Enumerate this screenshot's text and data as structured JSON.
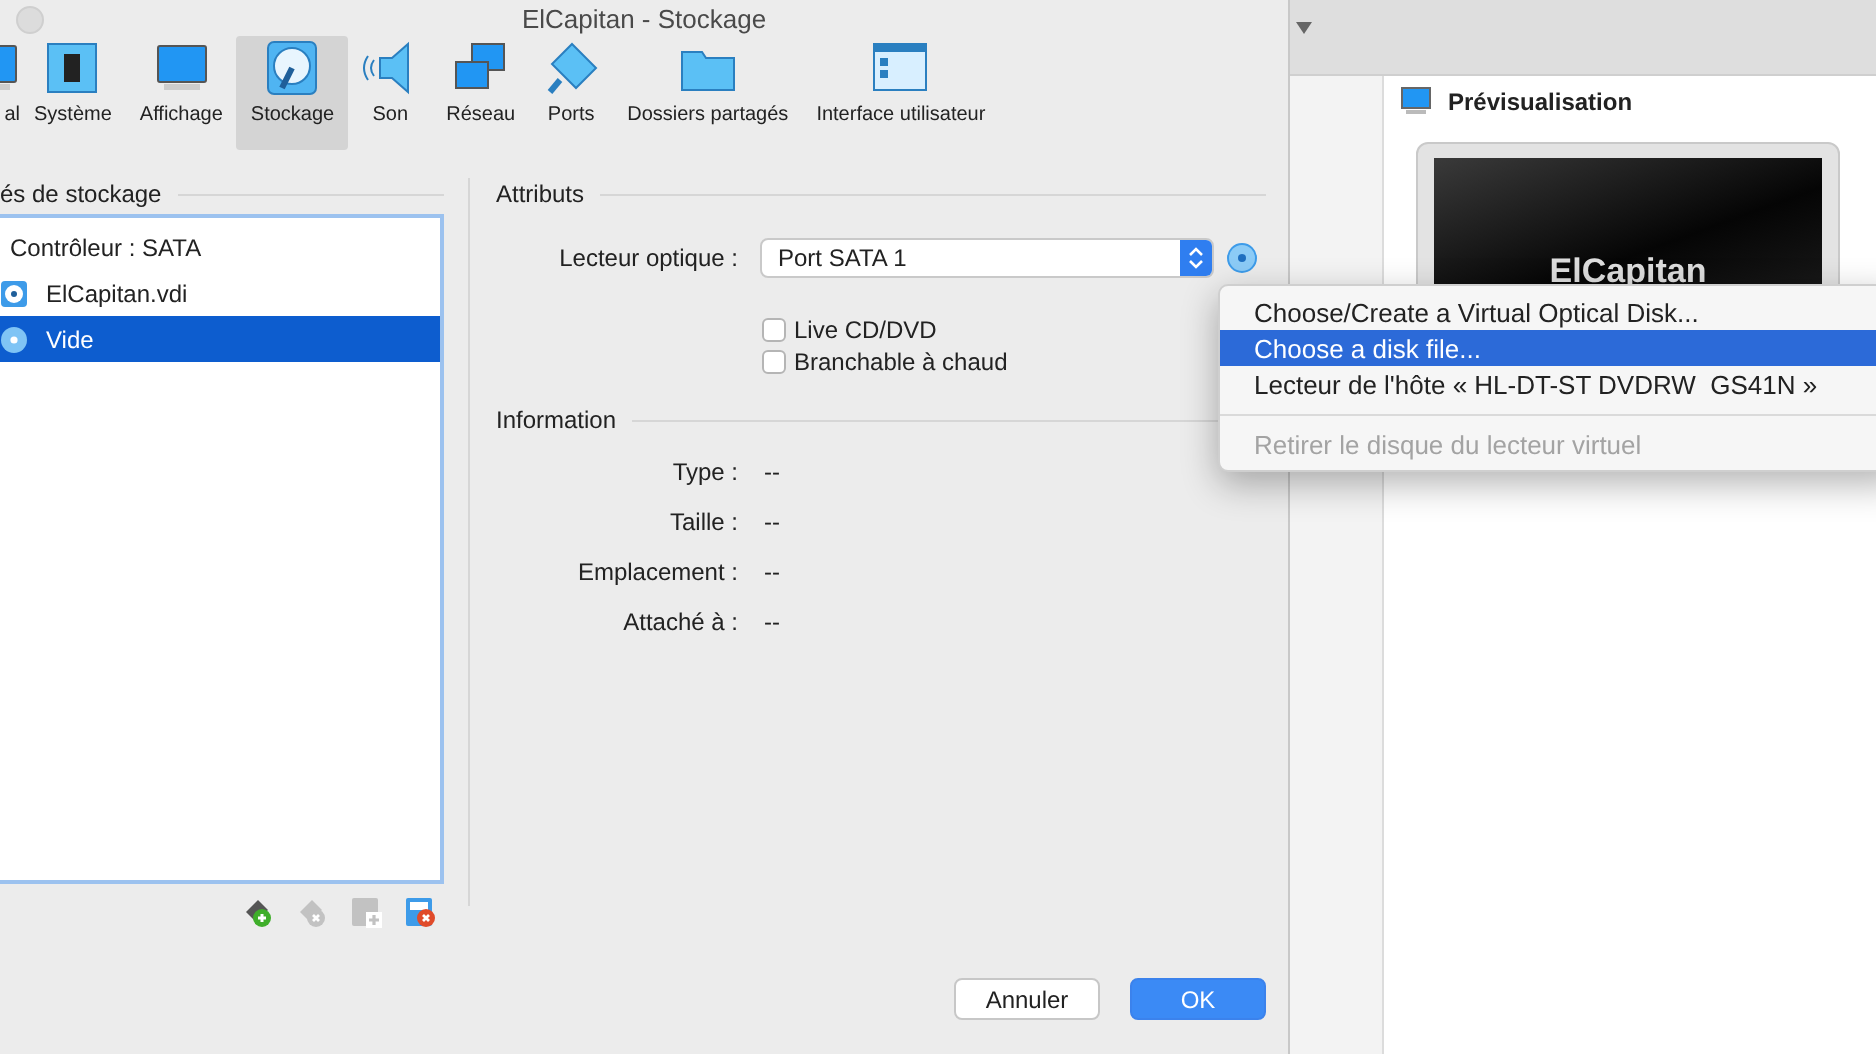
{
  "dialog": {
    "title": "ElCapitan - Stockage",
    "tabs": [
      {
        "label": "al",
        "kind": "general",
        "selected": false
      },
      {
        "label": "Système",
        "kind": "system",
        "selected": false
      },
      {
        "label": "Affichage",
        "kind": "display",
        "selected": false
      },
      {
        "label": "Stockage",
        "kind": "storage",
        "selected": true
      },
      {
        "label": "Son",
        "kind": "audio",
        "selected": false
      },
      {
        "label": "Réseau",
        "kind": "network",
        "selected": false
      },
      {
        "label": "Ports",
        "kind": "ports",
        "selected": false
      },
      {
        "label": "Dossiers partagés",
        "kind": "shared-folders",
        "selected": false
      },
      {
        "label": "Interface utilisateur",
        "kind": "user-interface",
        "selected": false
      }
    ],
    "storage": {
      "heading": "és de stockage",
      "tree": [
        {
          "label": "Contrôleur : SATA",
          "kind": "controller",
          "selected": false,
          "children": [
            {
              "label": "ElCapitan.vdi",
              "kind": "disk",
              "selected": false
            },
            {
              "label": "Vide",
              "kind": "optical",
              "selected": true
            }
          ]
        }
      ],
      "toolbar": [
        {
          "kind": "add-attachment",
          "disabled": false
        },
        {
          "kind": "remove-attachment",
          "disabled": true
        },
        {
          "kind": "add-controller",
          "disabled": true
        },
        {
          "kind": "remove-controller",
          "disabled": false
        }
      ]
    },
    "attributes": {
      "heading": "Attributs",
      "optical_drive": {
        "label": "Lecteur optique :",
        "value": "Port SATA 1"
      },
      "checkboxes": [
        {
          "label": "Live CD/DVD",
          "checked": false
        },
        {
          "label": "Branchable à chaud",
          "checked": false
        }
      ]
    },
    "information": {
      "heading": "Information",
      "rows": [
        {
          "label": "Type :",
          "value": "--"
        },
        {
          "label": "Taille :",
          "value": "--"
        },
        {
          "label": "Emplacement :",
          "value": "--"
        },
        {
          "label": "Attaché à :",
          "value": "--"
        }
      ]
    },
    "buttons": [
      {
        "label": "Annuler",
        "kind": "default"
      },
      {
        "label": "OK",
        "kind": "primary"
      }
    ]
  },
  "background_window": {
    "preview": {
      "heading": "Prévisualisation",
      "screen_label": "ElCapitan"
    }
  },
  "menu": {
    "items": [
      {
        "label": "Choose/Create a Virtual Optical Disk...",
        "selected": false,
        "disabled": false
      },
      {
        "label": "Choose a disk file...",
        "selected": true,
        "disabled": false
      },
      {
        "label": "Lecteur de l'hôte « HL-DT-ST DVDRW  GS41N »",
        "selected": false,
        "disabled": false
      },
      {
        "kind": "separator"
      },
      {
        "label": "Retirer le disque du lecteur virtuel",
        "selected": false,
        "disabled": true
      }
    ]
  }
}
